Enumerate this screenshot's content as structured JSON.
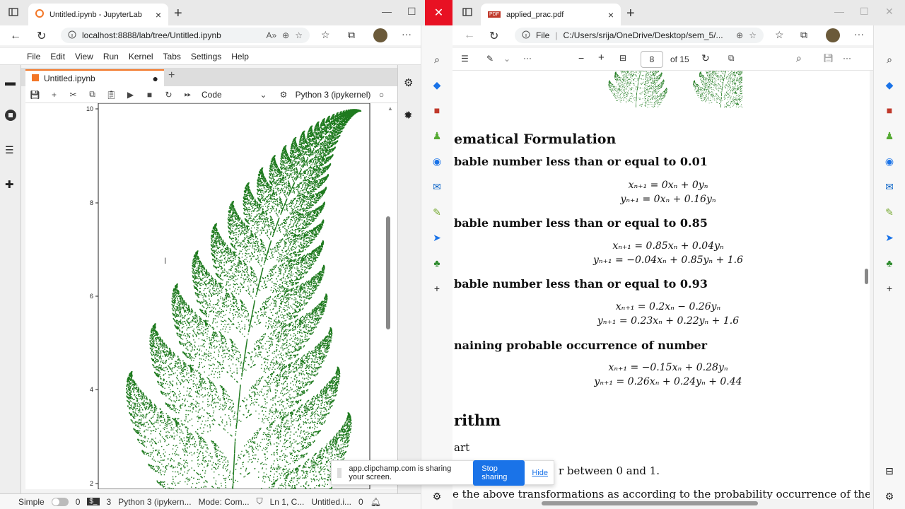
{
  "left_window": {
    "tab_title": "Untitled.ipynb - JupyterLab",
    "url": "localhost:8888/lab/tree/Untitled.ipynb",
    "menu": [
      "File",
      "Edit",
      "View",
      "Run",
      "Kernel",
      "Tabs",
      "Settings",
      "Help"
    ],
    "notebook_tab": "Untitled.ipynb",
    "cell_type": "Code",
    "kernel": "Python 3 (ipykernel)",
    "y_ticks": [
      "10",
      "8",
      "6",
      "4",
      "2"
    ],
    "status": {
      "mode": "Simple",
      "count_a": "0",
      "count_b": "3",
      "kernel_short": "Python 3 (ipykern...",
      "mode_text": "Mode: Com...",
      "position": "Ln 1, C...",
      "file": "Untitled.i...",
      "notif": "0"
    }
  },
  "right_window": {
    "tab_title": "applied_prac.pdf",
    "url_prefix": "File",
    "url": "C:/Users/srija/OneDrive/Desktop/sem_5/...",
    "page_number": "8",
    "page_total": "of 15",
    "pdf": {
      "section_title": "ematical Formulation",
      "case1_title": "bable number less than or equal to 0.01",
      "case1_eq1": "xₙ₊₁ = 0xₙ + 0yₙ",
      "case1_eq2": "yₙ₊₁ = 0xₙ + 0.16yₙ",
      "case2_title": "bable number less than or equal to 0.85",
      "case2_eq1": "xₙ₊₁ = 0.85xₙ + 0.04yₙ",
      "case2_eq2": "yₙ₊₁ = −0.04xₙ + 0.85yₙ + 1.6",
      "case3_title": "bable number less than or equal to 0.93",
      "case3_eq1": "xₙ₊₁ = 0.2xₙ − 0.26yₙ",
      "case3_eq2": "yₙ₊₁ = 0.23xₙ + 0.22yₙ + 1.6",
      "case4_title": "naining probable occurrence of number",
      "case4_eq1": "xₙ₊₁ = −0.15xₙ + 0.28yₙ",
      "case4_eq2": "yₙ₊₁ = 0.26xₙ + 0.24yₙ + 0.44",
      "algo_title": "rithm",
      "step1": "art",
      "step2": "r between 0 and 1.",
      "step3": "e the above transformations as according to the probability occurrence of the ran"
    }
  },
  "share_bar": {
    "message": "app.clipchamp.com is sharing your screen.",
    "stop": "Stop sharing",
    "hide": "Hide"
  },
  "colors": {
    "fern_green": "#1e7a1e",
    "jupyter_orange": "#f37626",
    "edge_blue": "#1a73e8",
    "close_red": "#e81123"
  }
}
